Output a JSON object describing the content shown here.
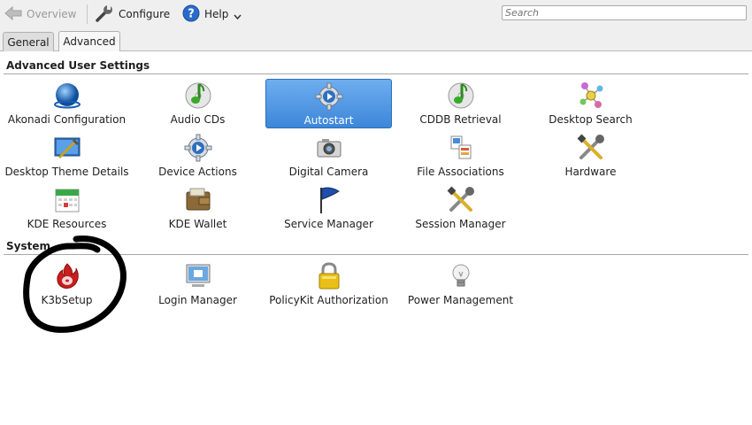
{
  "toolbar": {
    "overview_label": "Overview",
    "configure_label": "Configure",
    "help_label": "Help",
    "search_placeholder": "Search"
  },
  "tabs": [
    {
      "label": "General"
    },
    {
      "label": "Advanced"
    }
  ],
  "sections": [
    {
      "title": "Advanced User Settings",
      "items": [
        {
          "label": "Akonadi Configuration",
          "icon": "akonadi-icon"
        },
        {
          "label": "Audio CDs",
          "icon": "audio-cd-icon"
        },
        {
          "label": "Autostart",
          "icon": "autostart-gear-icon"
        },
        {
          "label": "CDDB Retrieval",
          "icon": "cddb-icon"
        },
        {
          "label": "Desktop Search",
          "icon": "desktop-search-icon"
        },
        {
          "label": "Desktop Theme Details",
          "icon": "desktop-theme-icon"
        },
        {
          "label": "Device Actions",
          "icon": "device-actions-icon"
        },
        {
          "label": "Digital Camera",
          "icon": "camera-icon"
        },
        {
          "label": "File Associations",
          "icon": "file-associations-icon"
        },
        {
          "label": "Hardware",
          "icon": "hardware-icon"
        },
        {
          "label": "KDE Resources",
          "icon": "calendar-icon"
        },
        {
          "label": "KDE Wallet",
          "icon": "wallet-icon"
        },
        {
          "label": "Service Manager",
          "icon": "flag-icon"
        },
        {
          "label": "Session Manager",
          "icon": "session-tools-icon"
        }
      ]
    },
    {
      "title": "System",
      "items": [
        {
          "label": "K3bSetup",
          "icon": "k3b-flame-icon"
        },
        {
          "label": "Login Manager",
          "icon": "login-monitor-icon"
        },
        {
          "label": "PolicyKit Authorization",
          "icon": "padlock-icon"
        },
        {
          "label": "Power Management",
          "icon": "lightbulb-icon"
        }
      ]
    }
  ],
  "selected_item": "Autostart",
  "colors": {
    "selection": "#4a90e2",
    "annotation": "#000000"
  }
}
